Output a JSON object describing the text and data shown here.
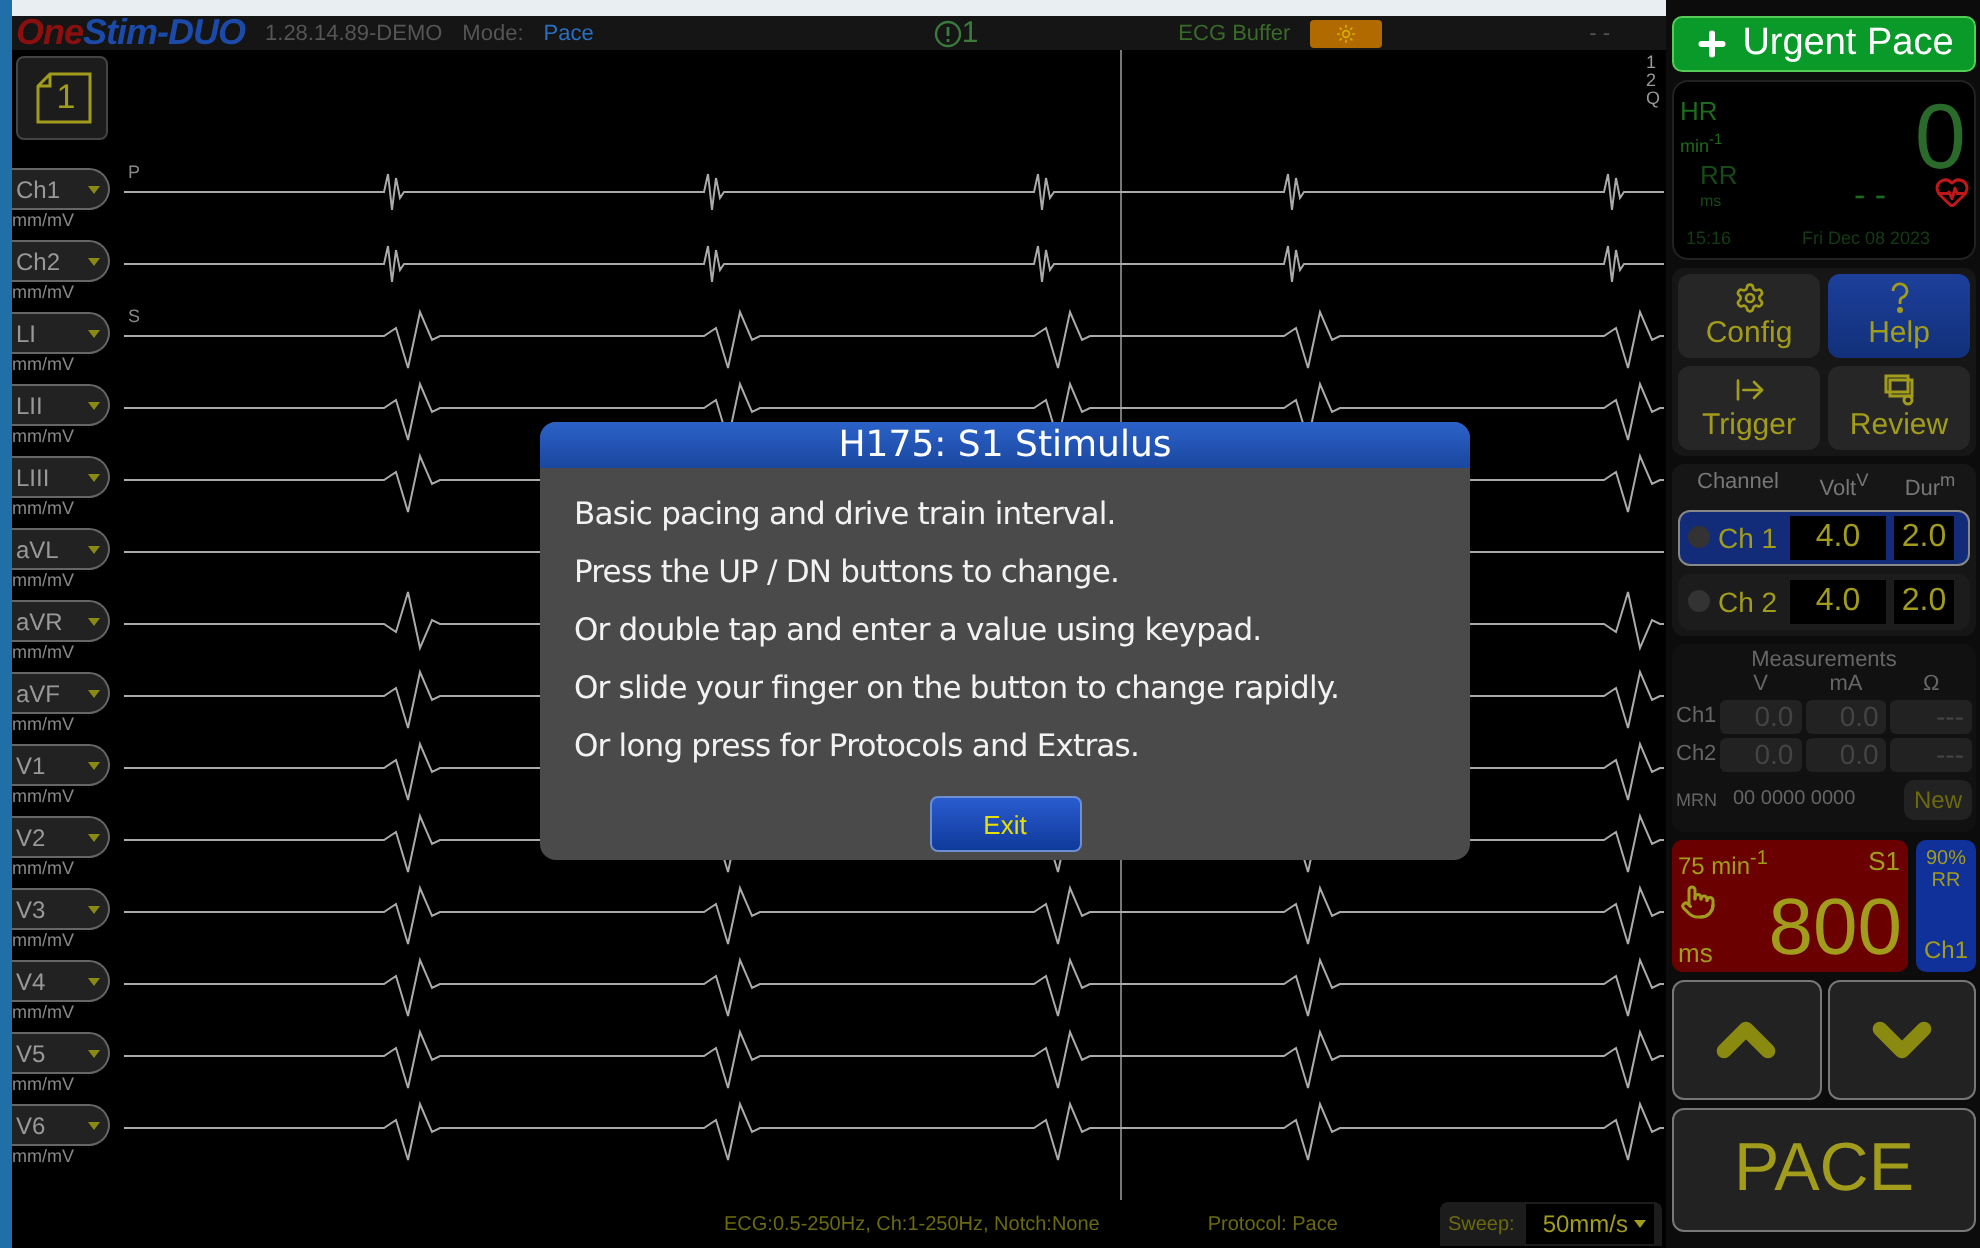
{
  "top_bar": {
    "logo_first": "One",
    "logo_second": "Stim-DUO",
    "version": "1.28.14.89-DEMO",
    "mode_label": "Mode:",
    "mode_value": "Pace",
    "alert_count": "1",
    "buffer_label": "ECG Buffer",
    "right_status": "- -"
  },
  "page_button": "1",
  "scale_labels": [
    "1",
    "2",
    "Q"
  ],
  "leads": [
    {
      "name": "Ch1",
      "unit": "mm/mV",
      "marker": "P",
      "kind": "spike"
    },
    {
      "name": "Ch2",
      "unit": "mm/mV",
      "kind": "spike"
    },
    {
      "name": "LI",
      "unit": "mm/mV",
      "marker": "S",
      "kind": "qrs"
    },
    {
      "name": "LII",
      "unit": "mm/mV",
      "kind": "qrs"
    },
    {
      "name": "LIII",
      "unit": "mm/mV",
      "kind": "qrs"
    },
    {
      "name": "aVL",
      "unit": "mm/mV",
      "kind": "flat"
    },
    {
      "name": "aVR",
      "unit": "mm/mV",
      "kind": "inverted"
    },
    {
      "name": "aVF",
      "unit": "mm/mV",
      "kind": "qrs"
    },
    {
      "name": "V1",
      "unit": "mm/mV",
      "kind": "qrs"
    },
    {
      "name": "V2",
      "unit": "mm/mV",
      "kind": "qrs"
    },
    {
      "name": "V3",
      "unit": "mm/mV",
      "kind": "qrs"
    },
    {
      "name": "V4",
      "unit": "mm/mV",
      "kind": "qrs"
    },
    {
      "name": "V5",
      "unit": "mm/mV",
      "kind": "qrs"
    },
    {
      "name": "V6",
      "unit": "mm/mV",
      "kind": "qrs"
    }
  ],
  "dialog": {
    "title": "H175: S1 Stimulus",
    "lines": [
      "Basic pacing and drive train interval.",
      "Press the UP / DN buttons to change.",
      "Or double tap and enter a value using keypad.",
      "Or slide your finger on the button to change rapidly.",
      "Or long press for Protocols and Extras."
    ],
    "button": "Exit"
  },
  "bottom_bar": {
    "filters": "ECG:0.5-250Hz, Ch:1-250Hz, Notch:None",
    "protocol": "Protocol: Pace",
    "sweep_label": "Sweep:",
    "sweep_value": "50mm/s"
  },
  "urgent_button": "Urgent Pace",
  "vitals": {
    "hr_label": "HR",
    "hr_unit": "min$^{-1}$",
    "hr_value": "0",
    "rr_label": "RR",
    "rr_unit": "ms",
    "rr_value": "- -",
    "time": "15:16",
    "date": "Fri Dec 08 2023"
  },
  "tools": [
    {
      "kind": "config",
      "label": "Config",
      "selected": false
    },
    {
      "kind": "help",
      "label": "Help",
      "selected": true
    },
    {
      "kind": "trigger",
      "label": "Trigger",
      "selected": false
    },
    {
      "kind": "review",
      "label": "Review",
      "selected": false
    }
  ],
  "channel_table": {
    "columns": [
      "Channel",
      "Volt$^{V}$",
      "Dur$^{m}$"
    ],
    "rows": [
      {
        "name": "Ch 1",
        "volt": "4.0",
        "dur": "2.0",
        "selected": true
      },
      {
        "name": "Ch 2",
        "volt": "4.0",
        "dur": "2.0",
        "selected": false
      }
    ]
  },
  "measurements": {
    "title": "Measurements",
    "columns": [
      "V",
      "mA",
      "Ω"
    ],
    "rows": [
      {
        "name": "Ch1",
        "values": [
          "0.0",
          "0.0",
          "---"
        ]
      },
      {
        "name": "Ch2",
        "values": [
          "0.0",
          "0.0",
          "---"
        ]
      }
    ],
    "mrn_label": "MRN",
    "mrn_value": "00 0000 0000",
    "new_button": "New"
  },
  "stimulus": {
    "rate": "75 min$^{-1}$",
    "name": "S1",
    "unit": "ms",
    "value": "800"
  },
  "rr_card": {
    "percent": "90%",
    "label": "RR",
    "channel": "Ch1"
  },
  "pace_button": "PACE"
}
